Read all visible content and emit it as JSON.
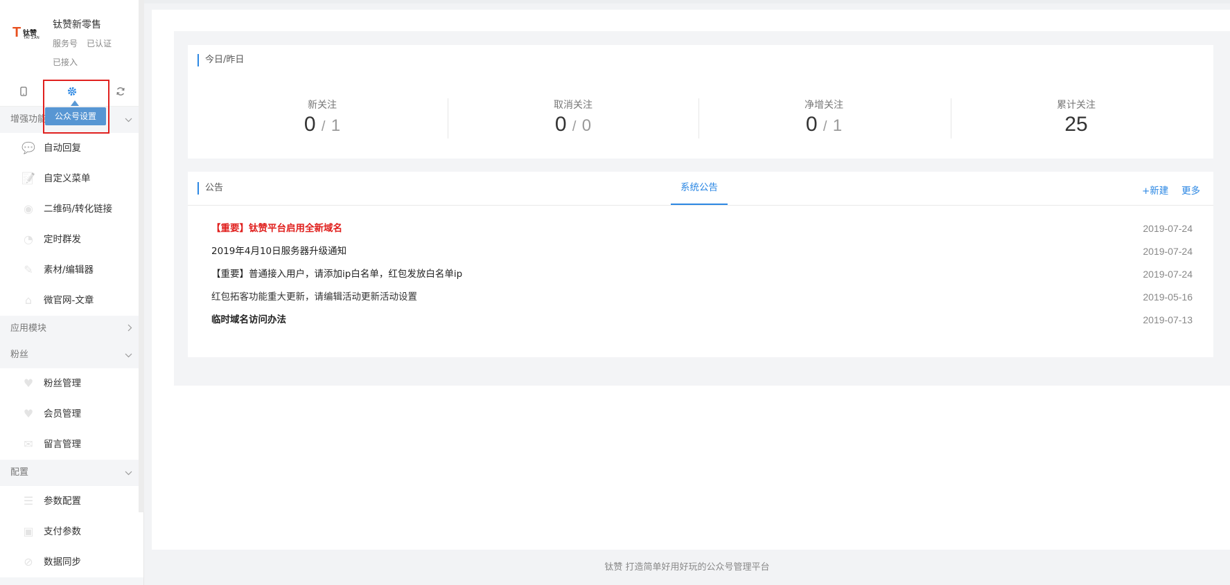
{
  "brand": {
    "logo_letter": "T",
    "logo_cn": "钛赞",
    "logo_en": "TAI ZAN",
    "name": "钛赞新零售",
    "type": "服务号",
    "verified": "已认证",
    "status": "已接入"
  },
  "toolbar": {
    "tooltip": "公众号设置"
  },
  "sidebar": {
    "sections": [
      {
        "label": "增强功能",
        "items": [
          "自动回复",
          "自定义菜单",
          "二维码/转化链接",
          "定时群发",
          "素材/编辑器",
          "微官网-文章"
        ]
      },
      {
        "label": "应用模块",
        "items": []
      },
      {
        "label": "粉丝",
        "items": [
          "粉丝管理",
          "会员管理",
          "留言管理"
        ]
      },
      {
        "label": "配置",
        "items": [
          "参数配置",
          "支付参数",
          "数据同步"
        ]
      }
    ]
  },
  "stats": {
    "title": "今日/昨日",
    "items": [
      {
        "label": "新关注",
        "today": "0",
        "yesterday": "1"
      },
      {
        "label": "取消关注",
        "today": "0",
        "yesterday": "0"
      },
      {
        "label": "净增关注",
        "today": "0",
        "yesterday": "1"
      },
      {
        "label": "累计关注",
        "value": "25"
      }
    ]
  },
  "notices": {
    "title": "公告",
    "tab": "系统公告",
    "new_label": "+新建",
    "more_label": "更多",
    "rows": [
      {
        "title": "【重要】钛赞平台启用全新域名",
        "date": "2019-07-24",
        "color": "#e0201e",
        "bold": true
      },
      {
        "title": "2019年4月10日服务器升级通知",
        "date": "2019-07-24",
        "color": "#222222",
        "bold": false
      },
      {
        "title": "【重要】普通接入用户，请添加ip白名单，红包发放白名单ip",
        "date": "2019-07-24",
        "color": "#222222",
        "bold": false
      },
      {
        "title": "红包拓客功能重大更新，请编辑活动更新活动设置",
        "date": "2019-05-16",
        "color": "#333333",
        "bold": false
      },
      {
        "title": "临时域名访问办法",
        "date": "2019-07-13",
        "color": "#222222",
        "bold": true
      }
    ]
  },
  "footer": {
    "text": "钛赞 打造简单好用好玩的公众号管理平台"
  },
  "colors": {
    "accent": "#2b87e3",
    "alert": "#e0201e"
  }
}
